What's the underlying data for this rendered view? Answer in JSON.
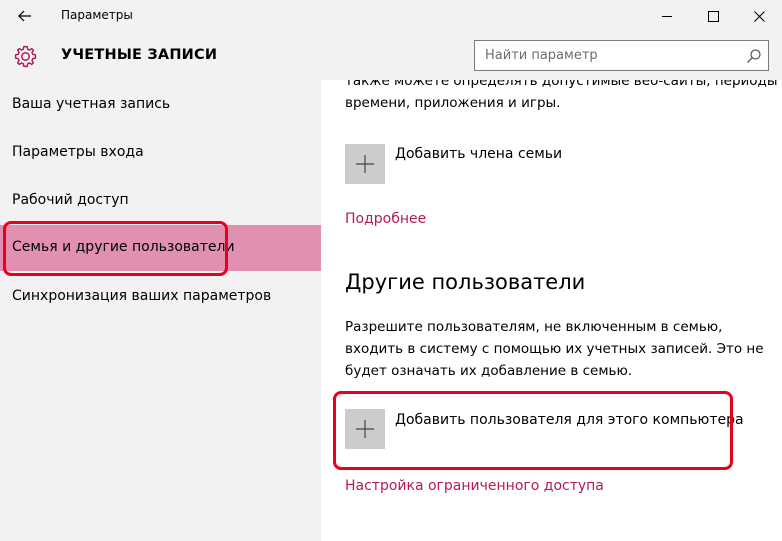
{
  "window": {
    "title": "Параметры"
  },
  "header": {
    "section_title": "УЧЕТНЫЕ ЗАПИСИ",
    "search_placeholder": "Найти параметр"
  },
  "sidebar": {
    "items": [
      {
        "label": "Ваша учетная запись"
      },
      {
        "label": "Параметры входа"
      },
      {
        "label": "Рабочий доступ"
      },
      {
        "label": "Семья и другие пользователи",
        "active": true
      },
      {
        "label": "Синхронизация ваших параметров"
      }
    ]
  },
  "main": {
    "family_text_line1": "также можете определять допустимые веб-сайты, периоды",
    "family_text_line2": "времени, приложения и игры.",
    "add_family_label": "Добавить члена семьи",
    "more_link": "Подробнее",
    "other_users_heading": "Другие пользователи",
    "other_users_text_line1": "Разрешите пользователям, не включенным в семью,",
    "other_users_text_line2": "входить в систему с помощью их учетных записей. Это не",
    "other_users_text_line3": "будет означать их добавление в семью.",
    "add_user_label": "Добавить пользователя для этого компьютера",
    "restricted_access_link": "Настройка ограниченного доступа"
  },
  "colors": {
    "accent": "#b4195a",
    "active_item_bg": "#e290b2",
    "highlight_box": "#e8001c",
    "sidebar_bg": "#f2f2f2"
  },
  "icons": {
    "back": "back-arrow-icon",
    "settings": "gear-icon",
    "search": "search-icon",
    "add": "plus-icon",
    "minimize": "minimize-icon",
    "maximize": "maximize-icon",
    "close": "close-icon"
  }
}
